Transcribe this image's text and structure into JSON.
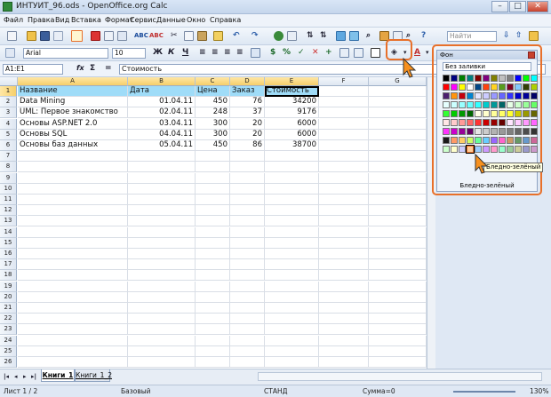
{
  "window": {
    "title": "ИНТУИТ_96.ods - OpenOffice.org Calc",
    "min_label": "–",
    "max_label": "□",
    "close_label": "✕"
  },
  "menu": [
    "Файл",
    "Правка",
    "Вид",
    "Вставка",
    "Формат",
    "Сервис",
    "Данные",
    "Окно",
    "Справка"
  ],
  "toolbar": {
    "find_placeholder": "Найти",
    "font_name": "Arial",
    "font_size": "10",
    "bold_label": "Ж",
    "italic_label": "К",
    "underline_label": "Ч"
  },
  "formula_bar": {
    "cell_ref": "A1:E1",
    "func_icon": "fx",
    "sum_icon": "Σ",
    "equals_label": "=",
    "content": "Стоимость"
  },
  "grid": {
    "columns": [
      "A",
      "B",
      "C",
      "D",
      "E",
      "F",
      "G"
    ],
    "rows": [
      "1",
      "2",
      "3",
      "4",
      "5",
      "6",
      "7",
      "8",
      "9",
      "10",
      "11",
      "12",
      "13",
      "14",
      "15",
      "16",
      "17",
      "18",
      "19",
      "20",
      "21",
      "22",
      "23",
      "24",
      "25",
      "26"
    ],
    "cells": [
      [
        "Название",
        "Дата",
        "Цена",
        "Заказ",
        "Стоимость"
      ],
      [
        "Data Mining",
        "01.04.11",
        "450",
        "76",
        "34200"
      ],
      [
        "UML: Первое знакомство",
        "02.04.11",
        "248",
        "37",
        "9176"
      ],
      [
        "Основы ASP.NET 2.0",
        "03.04.11",
        "300",
        "20",
        "6000"
      ],
      [
        "Основы SQL",
        "04.04.11",
        "300",
        "20",
        "6000"
      ],
      [
        "Основы баз данных",
        "05.04.11",
        "450",
        "86",
        "38700"
      ]
    ]
  },
  "sheet_tabs": [
    "Книги_1",
    "Книги_1_2"
  ],
  "status": {
    "sheet": "Лист 1 / 2",
    "style": "Базовый",
    "mode": "СТАНД",
    "sum": "Сумма=0",
    "zoom": "130%"
  },
  "palette": {
    "title": "Фон",
    "no_fill": "Без заливки",
    "hovered_name": "Бледно-зелёный",
    "tooltip": "Бледно-зелёный",
    "colors": [
      "#000000",
      "#000080",
      "#008000",
      "#008080",
      "#800000",
      "#800080",
      "#808000",
      "#c0c0c0",
      "#808080",
      "#0000ff",
      "#00ff00",
      "#00ffff",
      "#ff0000",
      "#ff00ff",
      "#ffff00",
      "#ffffff",
      "#004586",
      "#ff420e",
      "#ffd320",
      "#579d1c",
      "#7e0021",
      "#83caff",
      "#314004",
      "#aecf00",
      "#4b1f6f",
      "#ff950e",
      "#c5000b",
      "#0084d1",
      "#e6e6ff",
      "#ccccff",
      "#9999ff",
      "#6666ff",
      "#3333ff",
      "#0000cc",
      "#000099",
      "#000066",
      "#e6ffff",
      "#ccffff",
      "#99ffff",
      "#66ffff",
      "#33ffff",
      "#00cccc",
      "#009999",
      "#006666",
      "#e6ffe6",
      "#ccffcc",
      "#99ff99",
      "#66ff66",
      "#33ff33",
      "#00cc00",
      "#009900",
      "#006600",
      "#ffffe6",
      "#ffffcc",
      "#ffff99",
      "#ffff66",
      "#ffff33",
      "#cccc00",
      "#999900",
      "#666600",
      "#ffe6e6",
      "#ffcccc",
      "#ff9999",
      "#ff6666",
      "#ff3333",
      "#cc0000",
      "#990000",
      "#660000",
      "#ffe6ff",
      "#ffccff",
      "#ff99ff",
      "#ff66ff",
      "#ff33ff",
      "#cc00cc",
      "#990099",
      "#660066",
      "#e6e6e6",
      "#cccccc",
      "#b3b3b3",
      "#999999",
      "#808080",
      "#666666",
      "#4d4d4d",
      "#333333",
      "#1a1a1a",
      "#ff9966",
      "#ffcc66",
      "#ccff66",
      "#66ff99",
      "#66ccff",
      "#9966ff",
      "#ff66cc",
      "#cc9966",
      "#669966",
      "#6699cc",
      "#cc6699",
      "#ccffcc",
      "#ffffcc",
      "#ccccff",
      "#ffcc99",
      "#99ccff",
      "#cc99ff",
      "#ff99cc",
      "#99ffcc",
      "#99cc99",
      "#cccc99",
      "#9999cc",
      "#cc99cc"
    ]
  },
  "accent": "#e8702a"
}
